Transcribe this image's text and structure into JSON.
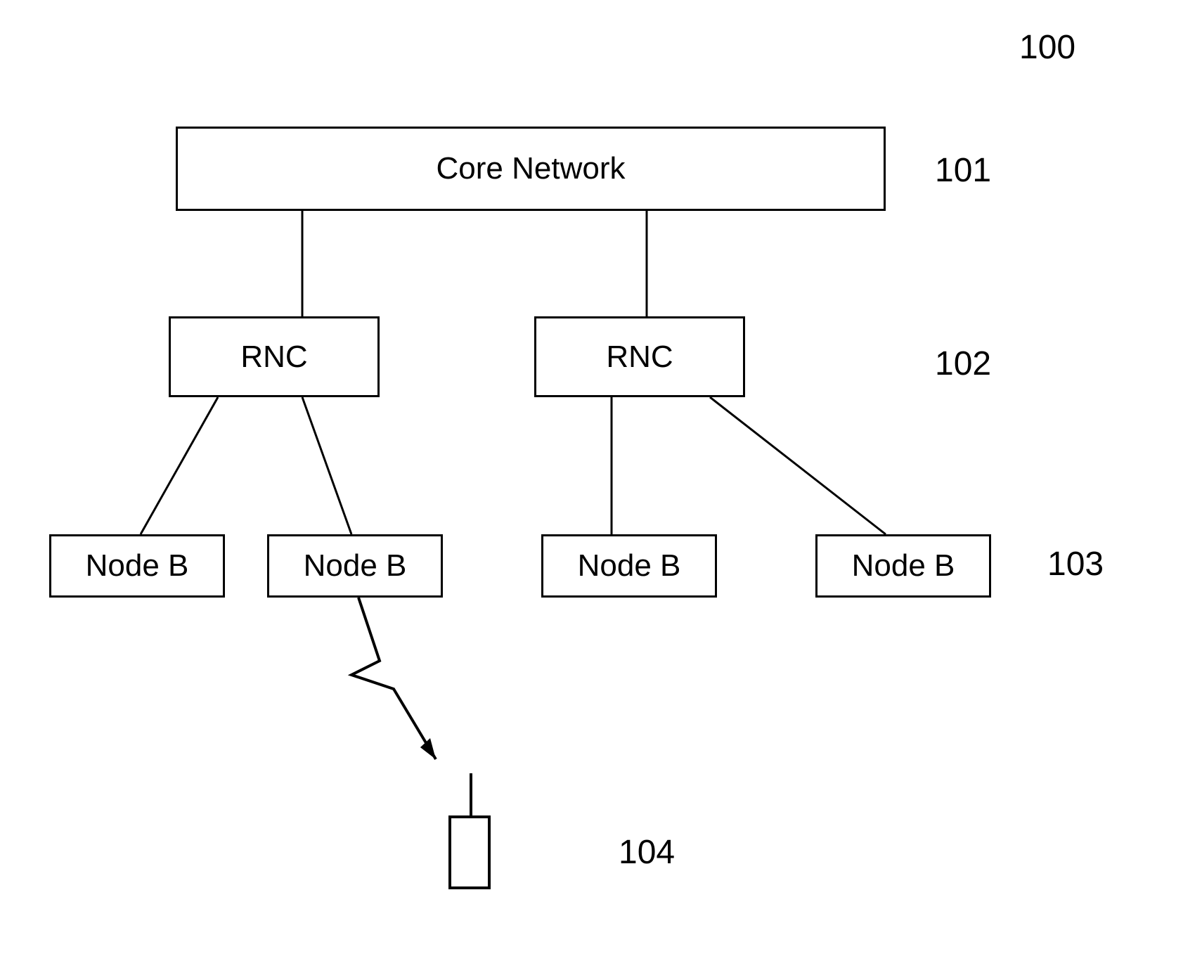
{
  "labels": {
    "diagram_number": "100",
    "core_network_num": "101",
    "rnc_num": "102",
    "nodeb_num": "103",
    "device_num": "104"
  },
  "boxes": {
    "core_network": "Core Network",
    "rnc1": "RNC",
    "rnc2": "RNC",
    "nodeb1": "Node B",
    "nodeb2": "Node B",
    "nodeb3": "Node B",
    "nodeb4": "Node B"
  }
}
